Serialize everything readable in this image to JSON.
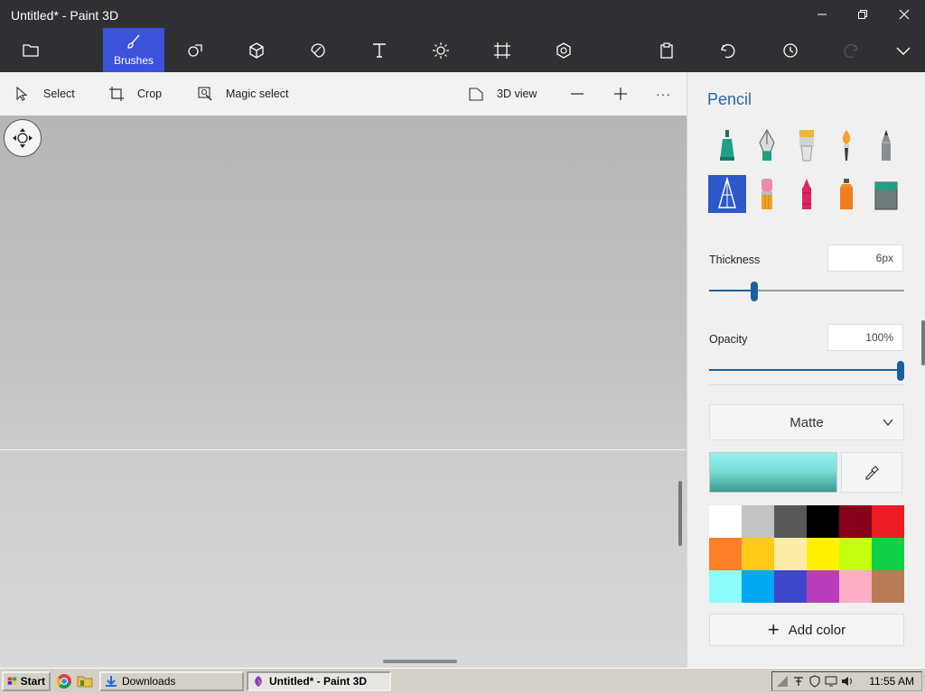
{
  "window": {
    "title": "Untitled* - Paint 3D",
    "minimize_glyph": "—",
    "restore_glyph": "❐",
    "close_glyph": "✕"
  },
  "ribbon": {
    "items": [
      {
        "name": "menu",
        "icon": "folder-icon"
      },
      {
        "name": "brushes",
        "label": "Brushes",
        "icon": "brush-icon",
        "active": true
      },
      {
        "name": "2d-shapes",
        "icon": "shapes-2d-icon"
      },
      {
        "name": "3d-shapes",
        "icon": "cube-icon"
      },
      {
        "name": "stickers",
        "icon": "sticker-icon"
      },
      {
        "name": "text",
        "icon": "text-icon"
      },
      {
        "name": "effects",
        "icon": "sun-icon"
      },
      {
        "name": "canvas",
        "icon": "canvas-icon"
      },
      {
        "name": "3d-library",
        "icon": "3d-library-icon"
      },
      {
        "name": "paste",
        "icon": "clipboard-icon"
      },
      {
        "name": "undo",
        "icon": "undo-icon"
      },
      {
        "name": "history",
        "icon": "history-icon"
      },
      {
        "name": "redo",
        "icon": "redo-icon"
      },
      {
        "name": "expand",
        "icon": "chevron-down-icon"
      }
    ]
  },
  "toolbar": {
    "select": "Select",
    "crop": "Crop",
    "magic_select": "Magic select",
    "view3d": "3D view",
    "zoom_out": "—",
    "zoom_in": "+",
    "more": "···"
  },
  "panel": {
    "title": "Pencil",
    "brushes": [
      "marker",
      "calligraphy-pen",
      "oil-brush",
      "watercolor",
      "pencil",
      "pencil-selected",
      "eraser",
      "crayon",
      "spray-can",
      "fill"
    ],
    "selected_brush": "pencil-selected",
    "thickness_label": "Thickness",
    "thickness_value": "6px",
    "thickness_level": 0.22,
    "opacity_label": "Opacity",
    "opacity_value": "100%",
    "opacity_level": 1.0,
    "finish": "Matte",
    "current_color": "#7bdfd6",
    "palette": [
      "#ffffff",
      "#c3c3c3",
      "#585858",
      "#000000",
      "#88001b",
      "#ec1c24",
      "#ff7f27",
      "#ffca18",
      "#fdeca6",
      "#fff200",
      "#c4ff0e",
      "#0ed145",
      "#8cfffb",
      "#00a8f3",
      "#3f48cc",
      "#b83dba",
      "#ffaec8",
      "#b97a56"
    ],
    "add_color": "Add color"
  },
  "taskbar": {
    "start": "Start",
    "downloads": "Downloads",
    "paint3d": "Untitled* - Paint 3D",
    "clock": "11:55 AM"
  },
  "colors": {
    "accent": "#3a53d9",
    "link_blue": "#2666b9",
    "slider": "#1d5f9e"
  }
}
